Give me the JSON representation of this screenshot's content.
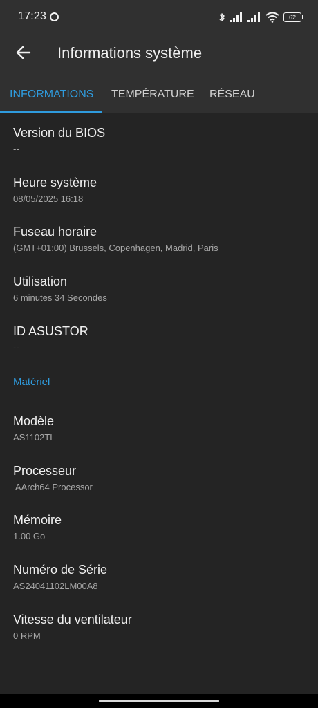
{
  "status_bar": {
    "time": "17:23",
    "battery": "62",
    "icons": [
      "bluetooth-icon",
      "signal-icon",
      "signal-icon",
      "wifi-icon",
      "battery-icon"
    ]
  },
  "app_bar": {
    "title": "Informations système",
    "back_icon": "arrow-left-icon"
  },
  "tabs": [
    {
      "label": "INFORMATIONS",
      "active": true
    },
    {
      "label": "TEMPÉRATURE",
      "active": false
    },
    {
      "label": "RÉSEAU",
      "active": false
    }
  ],
  "general": [
    {
      "label": "Version du BIOS",
      "value": "--"
    },
    {
      "label": "Heure système",
      "value": "08/05/2025 16:18"
    },
    {
      "label": "Fuseau horaire",
      "value": "(GMT+01:00) Brussels, Copenhagen, Madrid, Paris"
    },
    {
      "label": "Utilisation",
      "value": "6 minutes 34 Secondes"
    },
    {
      "label": "ID ASUSTOR",
      "value": "--"
    }
  ],
  "hardware_header": "Matériel",
  "hardware": [
    {
      "label": "Modèle",
      "value": "AS1102TL"
    },
    {
      "label": "Processeur",
      "value": " AArch64 Processor"
    },
    {
      "label": "Mémoire",
      "value": "1.00 Go"
    },
    {
      "label": "Numéro de Série",
      "value": "AS24041102LM00A8"
    },
    {
      "label": "Vitesse du ventilateur",
      "value": "0 RPM"
    }
  ],
  "colors": {
    "accent": "#2f9bdd",
    "background": "#242424",
    "bar": "#303030"
  }
}
